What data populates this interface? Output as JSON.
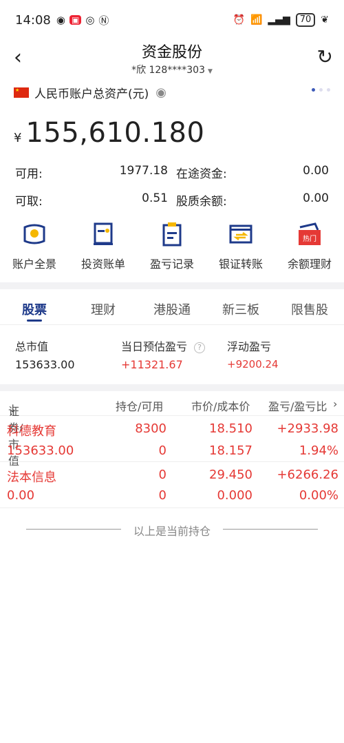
{
  "status_bar": {
    "time": "14:08",
    "battery": "70"
  },
  "header": {
    "title": "资金股份",
    "account": "*欣 128****303"
  },
  "asset": {
    "label": "人民币账户总资产(元)",
    "currency_symbol": "¥",
    "total": "155,610.180"
  },
  "funds": [
    {
      "label": "可用:",
      "value": "1977.18",
      "label2": "在途资金:",
      "value2": "0.00"
    },
    {
      "label": "可取:",
      "value": "0.51",
      "label2": "股质余额:",
      "value2": "0.00"
    }
  ],
  "actions": [
    {
      "label": "账户全景",
      "icon": "wallet-icon"
    },
    {
      "label": "投资账单",
      "icon": "bill-icon"
    },
    {
      "label": "盈亏记录",
      "icon": "clipboard-icon"
    },
    {
      "label": "银证转账",
      "icon": "transfer-icon"
    },
    {
      "label": "余额理财",
      "icon": "wallet-hot-icon",
      "badge": "热门"
    }
  ],
  "tabs": [
    "股票",
    "理财",
    "港股通",
    "新三板",
    "限售股"
  ],
  "summary": {
    "market_value_label": "总市值",
    "market_value": "153633.00",
    "daily_pl_label": "当日预估盈亏",
    "daily_pl": "+11321.67",
    "float_pl_label": "浮动盈亏",
    "float_pl": "+9200.24"
  },
  "table": {
    "headers": [
      "证券/市值",
      "持仓/可用",
      "市价/成本价",
      "盈亏/盈亏比"
    ],
    "rows": [
      {
        "name": "科德教育",
        "market_value": "153633.00",
        "position": "8300",
        "available": "0",
        "price": "18.510",
        "cost": "18.157",
        "pl": "+2933.98",
        "pl_ratio": "1.94%"
      },
      {
        "name": "法本信息",
        "market_value": "0.00",
        "position": "0",
        "available": "0",
        "price": "29.450",
        "cost": "0.000",
        "pl": "+6266.26",
        "pl_ratio": "0.00%"
      }
    ]
  },
  "footer": "以上是当前持仓",
  "colors": {
    "accent": "#1e3a8a",
    "gain": "#e53935",
    "hot": "#e53935"
  }
}
